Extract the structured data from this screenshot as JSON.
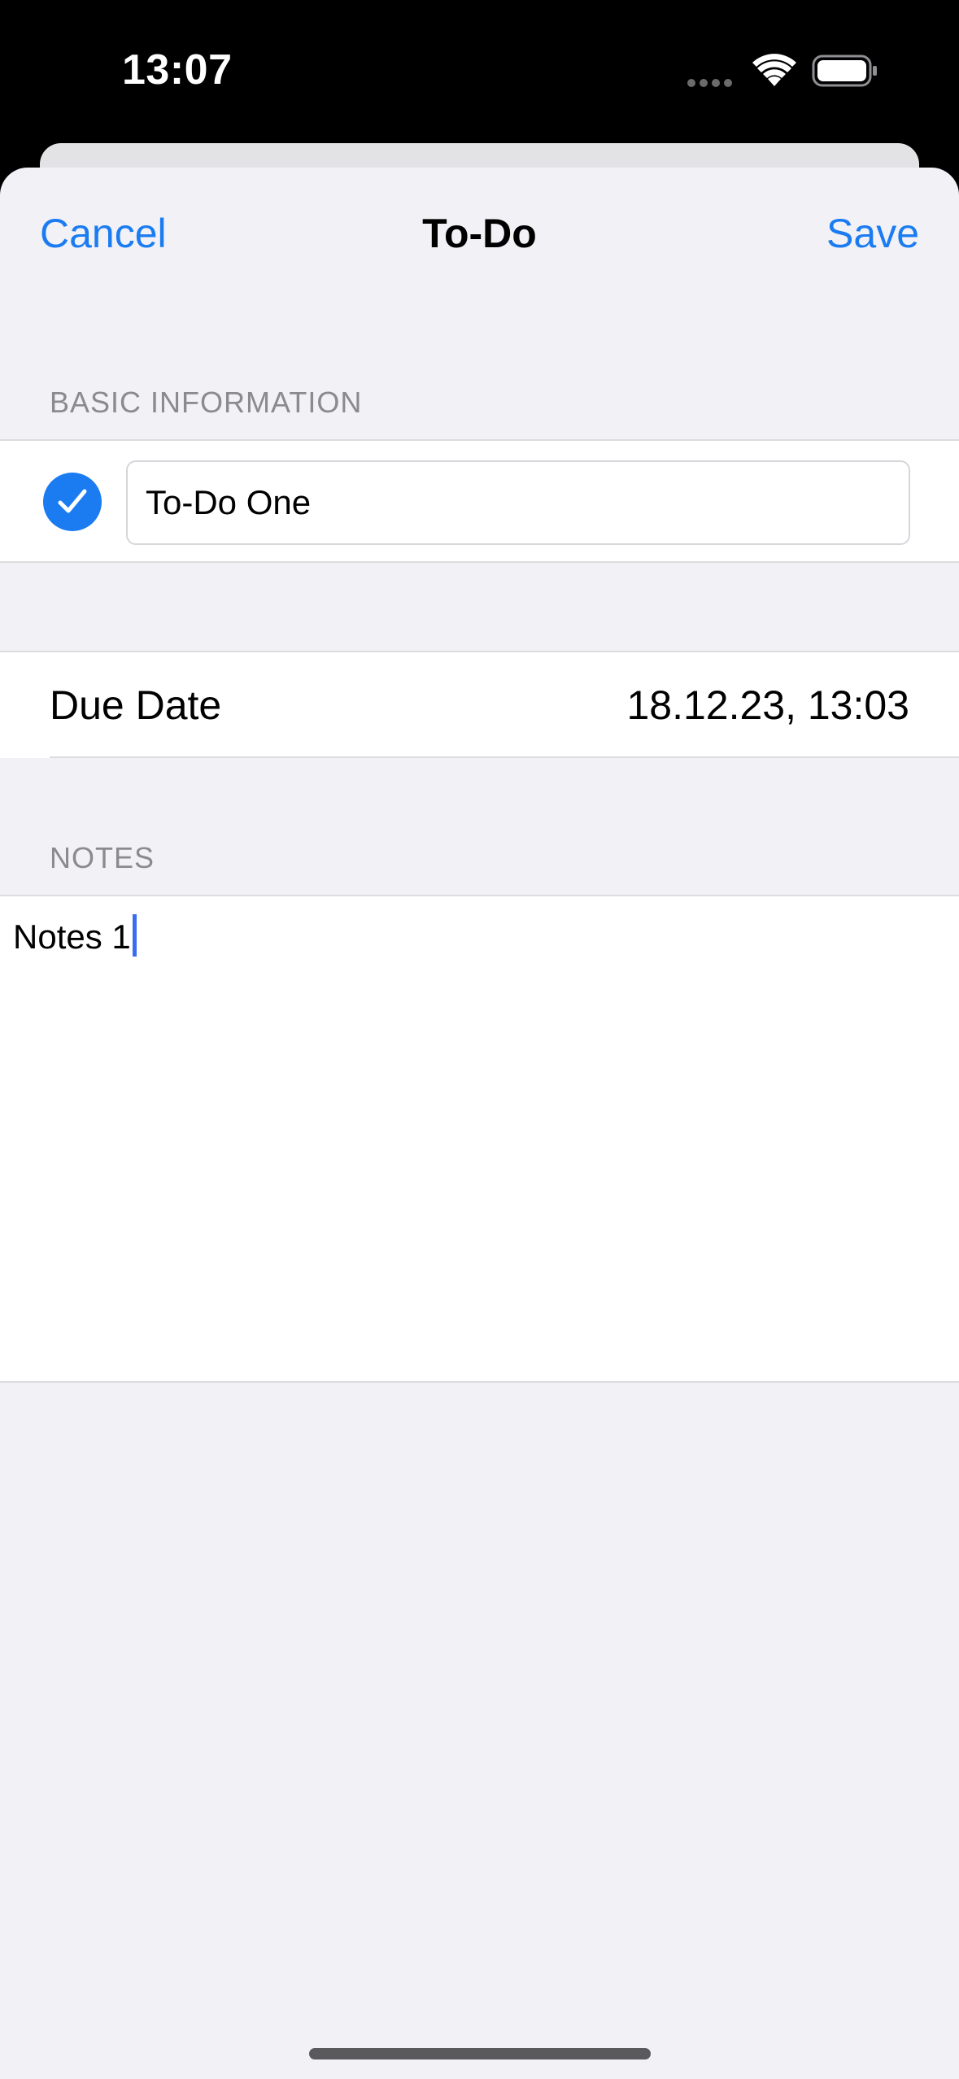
{
  "status_bar": {
    "time": "13:07"
  },
  "nav": {
    "cancel_label": "Cancel",
    "title": "To-Do",
    "save_label": "Save"
  },
  "basic_info": {
    "header": "BASIC INFORMATION",
    "completed": true,
    "title_value": "To-Do One"
  },
  "due_date": {
    "label": "Due Date",
    "value": "18.12.23, 13:03"
  },
  "notes": {
    "header": "NOTES",
    "text": "Notes 1"
  },
  "colors": {
    "accent": "#1b7cf2",
    "background": "#f1f1f6",
    "caret": "#3a6cf0"
  }
}
